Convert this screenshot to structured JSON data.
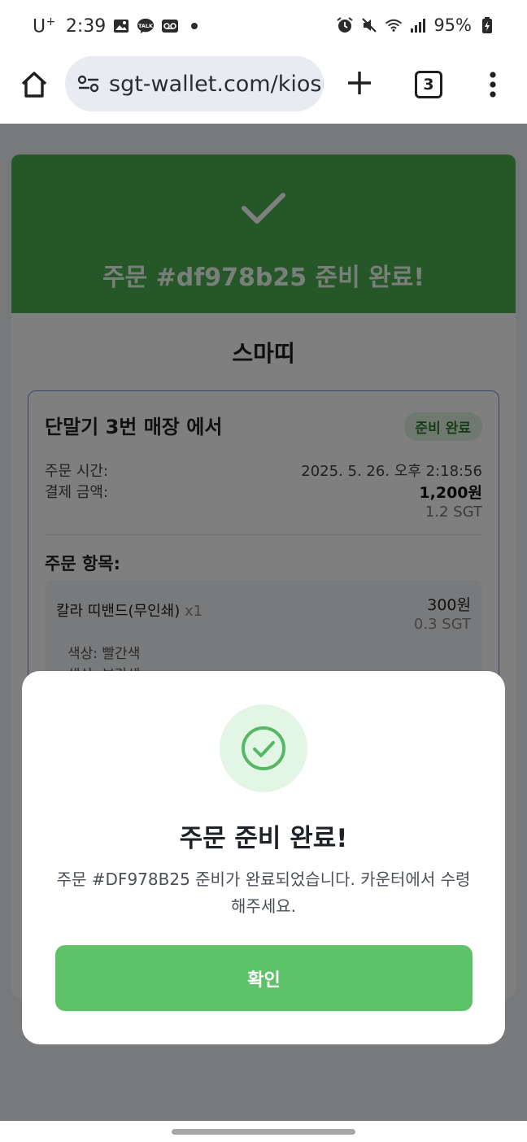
{
  "status_bar": {
    "carrier": "U",
    "carrier_sup": "+",
    "time": "2:39",
    "icons_left": [
      "gallery-icon",
      "kakaotalk-icon",
      "voicemail-icon",
      "dot-icon"
    ],
    "icons_right": [
      "alarm-icon",
      "mute-icon",
      "wifi-icon",
      "signal-icon"
    ],
    "battery": "95%"
  },
  "browser": {
    "url": "sgt-wallet.com/kiosk",
    "tab_count": "3"
  },
  "page": {
    "header_title": "주문 #df978b25 준비 완료!",
    "store_name": "스마띠",
    "order": {
      "title": "단말기 3번 매장 에서",
      "badge": "준비 완료",
      "time_label": "주문 시간:",
      "time_value": "2025. 5. 26. 오후 2:18:56",
      "amount_label": "결제 금액:",
      "amount_value": "1,200원",
      "amount_sgt": "1.2 SGT",
      "items_label": "주문 항목:",
      "items": [
        {
          "name": "칼라 띠밴드(무인쇄)",
          "qty": "x1",
          "price": "300원",
          "price_sgt": "0.3 SGT",
          "options": [
            "색상: 빨간색",
            "색상: 보라색"
          ]
        }
      ]
    }
  },
  "modal": {
    "title": "주문 준비 완료!",
    "message": "주문 #DF978B25 준비가 완료되었습니다. 카운터에서 수령해주세요.",
    "confirm_label": "확인"
  },
  "colors": {
    "header_green": "#4caf50",
    "confirm_green": "#5ec268",
    "badge_bg": "#dff3df",
    "badge_text": "#2f7d33",
    "order_border": "#7b8fd8"
  }
}
